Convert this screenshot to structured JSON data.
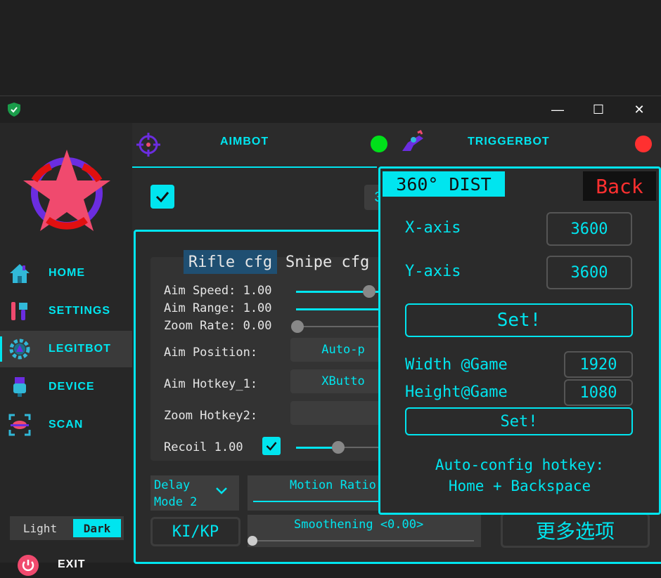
{
  "window": {
    "minimize_icon": "minimize-icon",
    "maximize_icon": "maximize-icon",
    "close_icon": "close-icon",
    "minimize": "—",
    "maximize": "☐",
    "close": "✕"
  },
  "sidebar": {
    "items": [
      {
        "label": "HOME",
        "icon": "home-icon"
      },
      {
        "label": "SETTINGS",
        "icon": "tools-icon"
      },
      {
        "label": "LEGITBOT",
        "icon": "gear-icon"
      },
      {
        "label": "DEVICE",
        "icon": "usb-icon"
      },
      {
        "label": "SCAN",
        "icon": "scan-icon"
      }
    ],
    "theme_light": "Light",
    "theme_dark": "Dark",
    "exit": "EXIT"
  },
  "tabs": {
    "aimbot": "AIMBOT",
    "triggerbot": "TRIGGERBOT",
    "aimbot_status": "#00e01a",
    "triggerbot_status": "#ff3030"
  },
  "aim": {
    "partial_value": "3",
    "cfg_tabs": [
      "Rifle cfg",
      "Snipe cfg"
    ],
    "speed_label": "Aim Speed: 1.00",
    "range_label": "Aim Range: 1.00",
    "zoom_rate_label": "Zoom Rate: 0.00",
    "position_label": "Aim Position:",
    "position_value": "Auto-p",
    "hotkey1_label": "Aim Hotkey_1:",
    "hotkey1_value": "XButto",
    "hotkey2_label": "Zoom Hotkey2:",
    "recoil_label": "Recoil 1.00",
    "delay_mode": "Delay\nMode 2",
    "motion_ratio": "Motion Ratio",
    "kikp": "KI/KP",
    "smoothening": "Smoothening <0.00>",
    "more_options": "更多选项"
  },
  "dist_panel": {
    "title": "360° DIST",
    "back": "Back",
    "x_label": "X-axis",
    "x_value": "3600",
    "y_label": "Y-axis",
    "y_value": "3600",
    "set1": "Set!",
    "width_label": "Width @Game",
    "width_value": "1920",
    "height_label": "Height@Game",
    "height_value": "1080",
    "set2": "Set!",
    "hint_line1": "Auto-config hotkey:",
    "hint_line2": "Home + Backspace"
  }
}
